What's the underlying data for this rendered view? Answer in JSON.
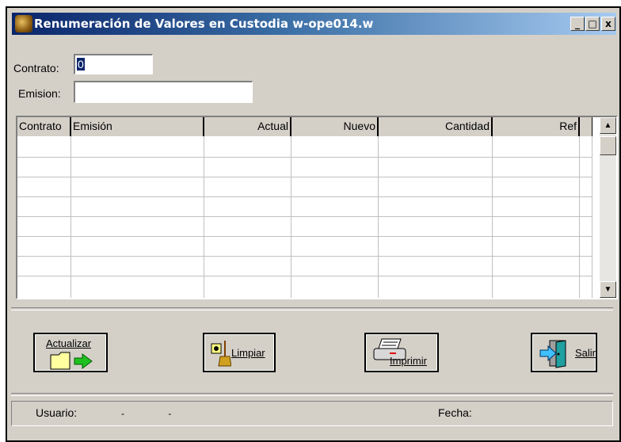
{
  "window": {
    "title": "Renumeración  de Valores en Custodia w-ope014.w",
    "controls": {
      "minimize": "_",
      "maximize": "□",
      "close": "x"
    }
  },
  "form": {
    "contrato_label": "Contrato:",
    "contrato_value": "0",
    "emision_label": "Emision:",
    "emision_value": ""
  },
  "grid": {
    "columns": [
      "Contrato",
      "Emisión",
      "Actual",
      "Nuevo",
      "Cantidad",
      "Ref"
    ],
    "rows": []
  },
  "buttons": {
    "actualizar": "Actualizar",
    "limpiar": "Limpiar",
    "imprimir": "Imprimir",
    "salir": "Salir"
  },
  "status": {
    "usuario_label": "Usuario:",
    "usuario_value": "- -",
    "fecha_label": "Fecha:",
    "fecha_value": ""
  }
}
